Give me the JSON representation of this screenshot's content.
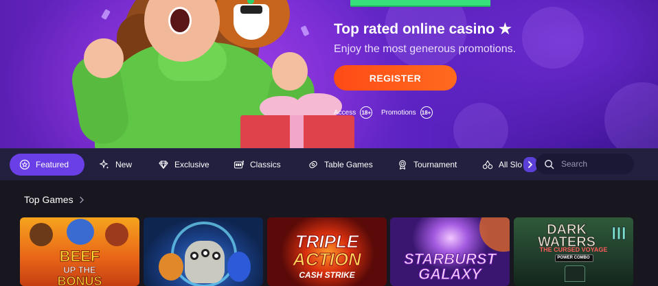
{
  "hero": {
    "title": "Top rated online casino ★",
    "subtitle": "Enjoy the most generous promotions.",
    "register_label": "REGISTER",
    "links": [
      {
        "label": "Access",
        "badge": "18+"
      },
      {
        "label": "Promotions",
        "badge": "18+"
      }
    ]
  },
  "categories": {
    "items": [
      {
        "label": "Featured",
        "icon": "star-circle-icon",
        "active": true
      },
      {
        "label": "New",
        "icon": "sparkle-icon",
        "active": false
      },
      {
        "label": "Exclusive",
        "icon": "diamond-icon",
        "active": false
      },
      {
        "label": "Classics",
        "icon": "slot-machine-icon",
        "active": false
      },
      {
        "label": "Table Games",
        "icon": "chip-icon",
        "active": false
      },
      {
        "label": "Tournament",
        "icon": "medal-icon",
        "active": false
      },
      {
        "label": "All Slo",
        "icon": "cherries-icon",
        "active": false
      }
    ],
    "scroll_icon": "chevron-right-icon"
  },
  "search": {
    "placeholder": "Search",
    "icon": "search-icon"
  },
  "top_games": {
    "heading": "Top Games",
    "games": [
      {
        "title_line1": "BEEF",
        "title_line2": "UP THE",
        "title_line3": "BONUS"
      },
      {
        "title_line1": "",
        "title_line2": "",
        "title_line3": ""
      },
      {
        "title_line1": "TRIPLE",
        "title_line2": "ACTION",
        "title_line3": "CASH STRIKE"
      },
      {
        "title_line1": "STARBURST",
        "title_line2": "GALAXY",
        "title_line3": ""
      },
      {
        "title_line1": "DARK",
        "title_line2": "WATERS",
        "title_line3": "THE CURSED VOYAGE",
        "title_line4": "POWER COMBO",
        "numeral": "III"
      }
    ]
  },
  "colors": {
    "accent": "#6a3fe5",
    "register": "#ff5a1a",
    "nav_bg": "#221f3f",
    "page_bg": "#18171f"
  }
}
